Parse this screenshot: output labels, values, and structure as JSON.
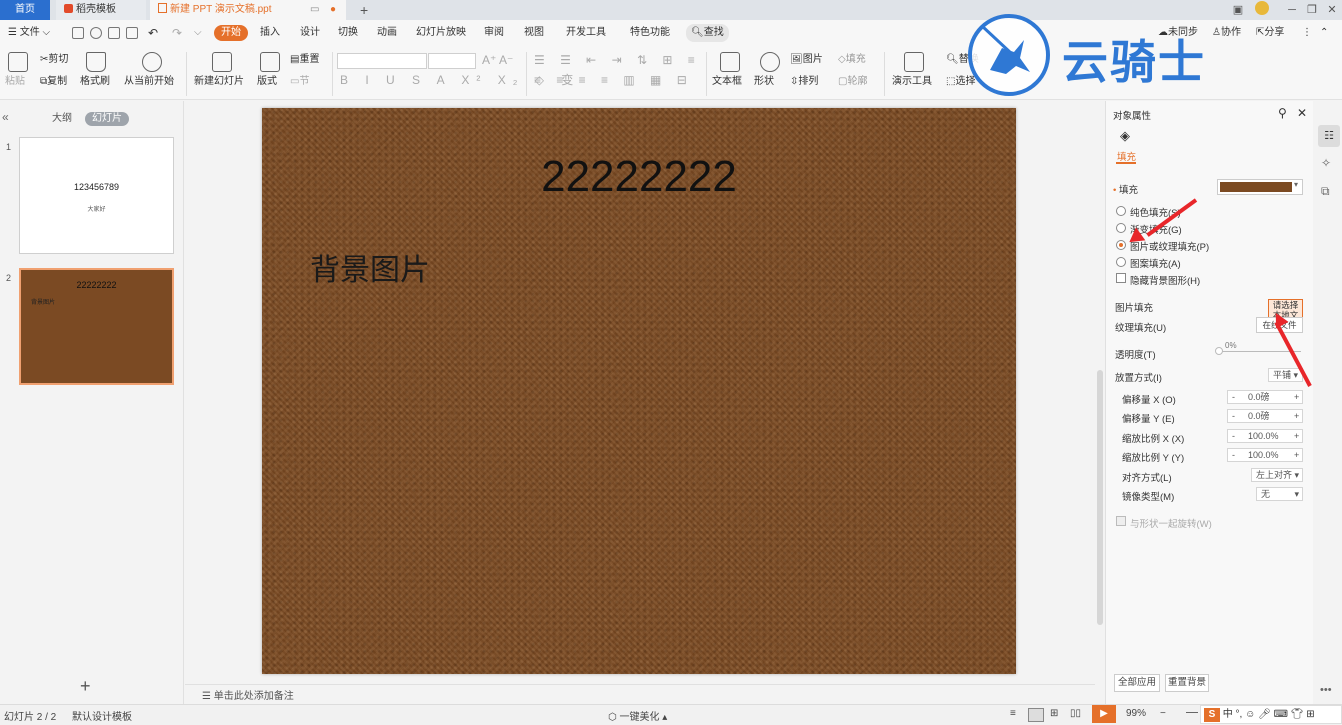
{
  "tabs": {
    "home": "首页",
    "template": "稻壳模板",
    "document": "新建 PPT 演示文稿.ppt"
  },
  "menu": {
    "file": "文件",
    "start": "开始",
    "items": [
      "插入",
      "设计",
      "切换",
      "动画",
      "幻灯片放映",
      "审阅",
      "视图",
      "开发工具",
      "特色功能"
    ],
    "search": "查找",
    "sync": "未同步",
    "collab": "协作",
    "share": "分享"
  },
  "ribbon": {
    "paste": "粘贴",
    "cut": "剪切",
    "copy": "复制",
    "format_painter": "格式刷",
    "from_current": "从当前开始",
    "new_slide": "新建幻灯片",
    "layout": "版式",
    "reset": "重置",
    "section": "节",
    "textbox": "文本框",
    "shape": "形状",
    "picture": "图片",
    "fill": "填充",
    "arrange": "排列",
    "outline": "轮廓",
    "present_tools": "演示工具",
    "replace": "替换",
    "select": "选择"
  },
  "left_panel": {
    "outline_tab": "大纲",
    "slides_tab": "幻灯片",
    "slides": [
      {
        "num": "1",
        "title": "123456789",
        "sub": "大家好"
      },
      {
        "num": "2",
        "title": "22222222",
        "sub": "背景图片"
      }
    ],
    "add": "+"
  },
  "slide": {
    "title": "22222222",
    "text": "背景图片",
    "notes_placeholder": "单击此处添加备注"
  },
  "props": {
    "header": "对象属性",
    "tab_fill": "填充",
    "fill_label": "填充",
    "fill_color": "#7b4a22",
    "options": [
      "纯色填充(S)",
      "渐变填充(G)",
      "图片或纹理填充(P)",
      "图案填充(A)"
    ],
    "selected_index": 2,
    "hide_bg": "隐藏背景图形(H)",
    "picture_fill": "图片填充",
    "picture_fill_btn": "请选择",
    "picture_fill_btn2": "本地文件",
    "texture_fill": "纹理填充(U)",
    "texture_fill_btn": "在线文件",
    "transparency": "透明度(T)",
    "transparency_val": "0%",
    "placement": "放置方式(I)",
    "placement_val": "平铺",
    "offset_x": "偏移量 X (O)",
    "offset_x_val": "0.0磅",
    "offset_y": "偏移量 Y (E)",
    "offset_y_val": "0.0磅",
    "scale_x": "缩放比例 X (X)",
    "scale_x_val": "100.0%",
    "scale_y": "缩放比例 Y (Y)",
    "scale_y_val": "100.0%",
    "align": "对齐方式(L)",
    "align_val": "左上对齐",
    "mirror": "镜像类型(M)",
    "mirror_val": "无",
    "rotate_with_shape": "与形状一起旋转(W)",
    "apply_all": "全部应用",
    "reset_bg": "重置背景"
  },
  "status": {
    "slide_count": "幻灯片 2 / 2",
    "template": "默认设计模板",
    "beautify": "一键美化",
    "zoom": "99%"
  },
  "watermark": {
    "text": "云骑士"
  },
  "colors": {
    "accent": "#e5702a",
    "home_tab": "#2b6fcf",
    "watermark": "#2f78d4",
    "arrow": "#e8262a"
  }
}
